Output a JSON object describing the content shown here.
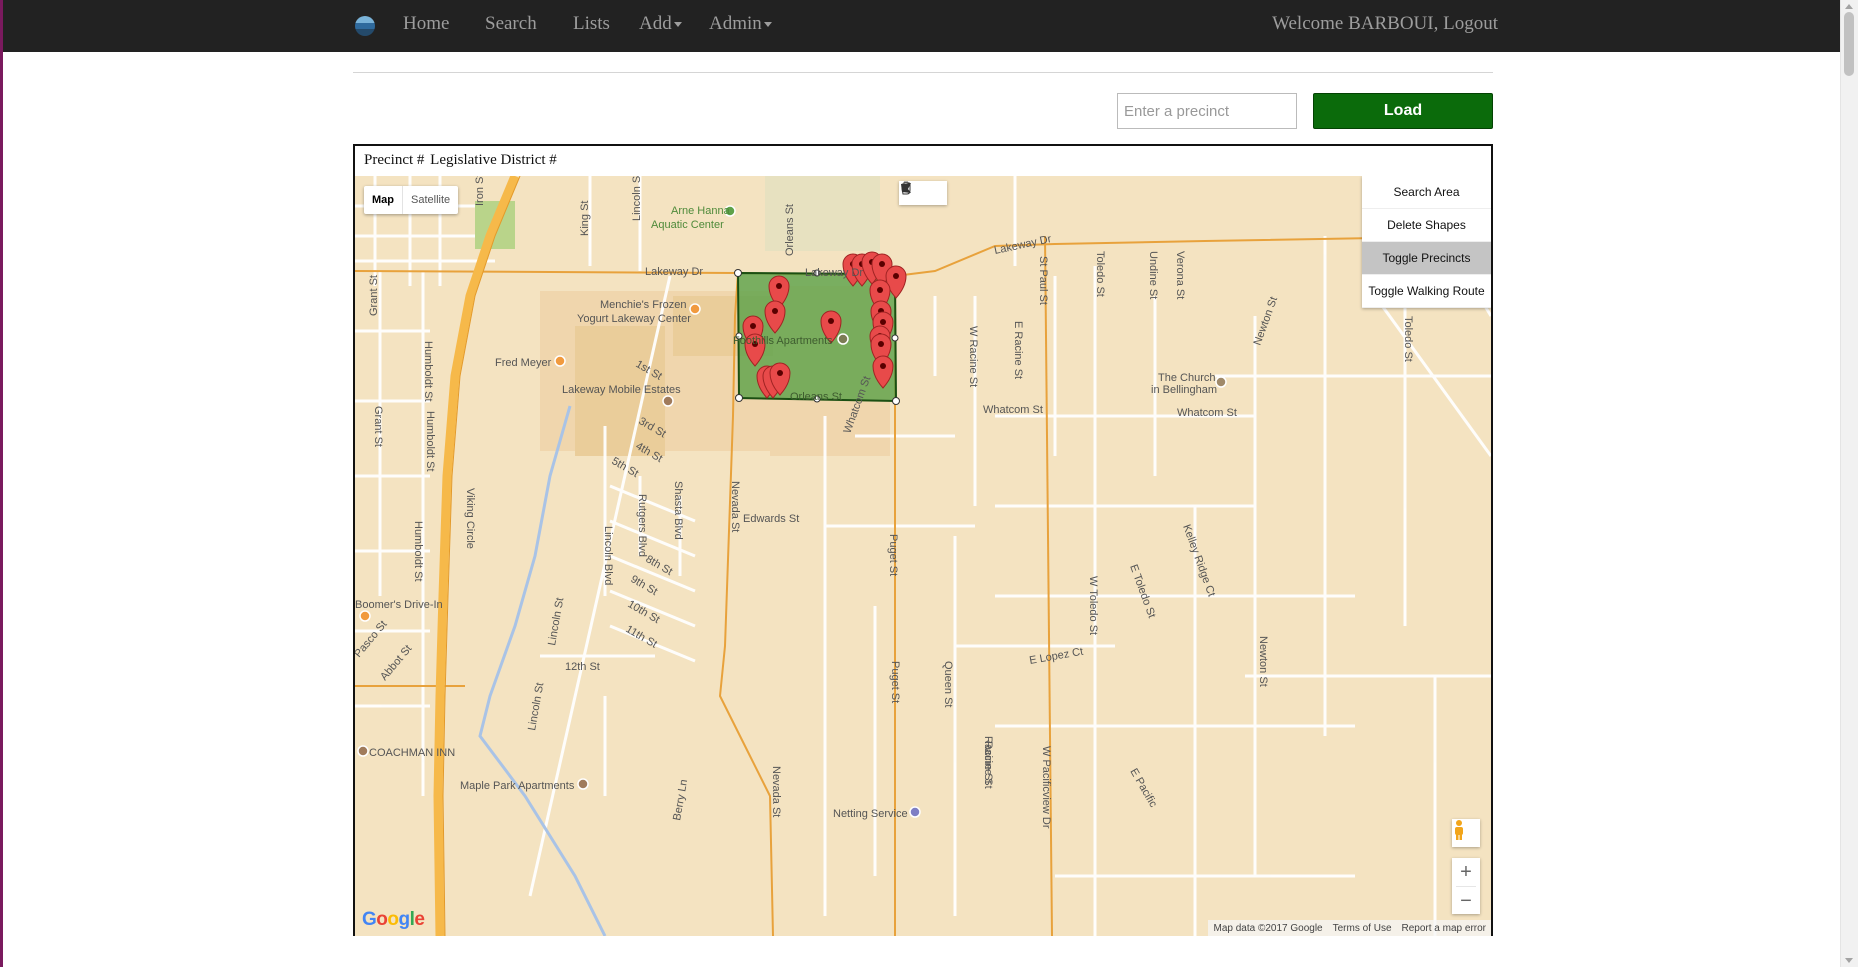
{
  "navbar": {
    "links": [
      {
        "label": "Home"
      },
      {
        "label": "Search"
      },
      {
        "label": "Lists"
      },
      {
        "label": "Add"
      },
      {
        "label": "Admin"
      }
    ],
    "welcome": "Welcome BARBOUI,",
    "logout": "Logout"
  },
  "search": {
    "placeholder": "Enter a precinct",
    "value": "",
    "load_label": "Load"
  },
  "map_panel": {
    "precinct_label": "Precinct #",
    "district_label": "Legislative District #"
  },
  "map": {
    "type_controls": {
      "map": "Map",
      "satellite": "Satellite",
      "selected": "Map"
    },
    "draw_tools": [
      {
        "icon": "hand-icon"
      },
      {
        "icon": "polygon-draw-icon"
      }
    ],
    "custom_controls": {
      "search_area": "Search Area",
      "delete_shapes": "Delete Shapes",
      "toggle_precincts": "Toggle Precincts",
      "toggle_walking_route": "Toggle Walking Route"
    },
    "zoom_in": "+",
    "zoom_out": "−",
    "logo": "Google",
    "attribution": {
      "data": "Map data ©2017 Google",
      "terms": "Terms of Use",
      "report": "Report a map error"
    },
    "colors": {
      "land": "#f4e3c1",
      "highway": "#f6b94a",
      "arterial": "#e8a23c",
      "selection_fill": "#5ea24a",
      "selection_stroke": "#1b4f12",
      "marker": "#e84a4a"
    },
    "labels": [
      "Iron St",
      "King St",
      "Lincoln St",
      "Arne Hanna",
      "Aquatic Center",
      "Orleans St",
      "Lakeway Dr",
      "Lakeway Dr",
      "Lakeway Dr",
      "Grant St",
      "Humboldt St",
      "Menchie's Frozen",
      "Yogurt Lakeway Center",
      "Fred Meyer",
      "1st St",
      "Lakeway Mobile Estates",
      "3rd St",
      "4th St",
      "5th St",
      "Shasta Blvd",
      "Rutgers Blvd",
      "Lincoln Blvd",
      "8th St",
      "9th St",
      "10th St",
      "11th St",
      "12th St",
      "Viking Circle",
      "Boomer's Drive-In",
      "Pasco St",
      "Abbot St",
      "COACHMAN INN",
      "Maple Park Apartments",
      "Nevada St",
      "Edwards St",
      "Puget St",
      "Queen St",
      "Racine St",
      "St Paul St",
      "Toledo St",
      "Undine St",
      "Verona St",
      "W Racine St",
      "E Racine St",
      "Whatcom St",
      "Whatcom St",
      "The Church",
      "in Bellingham",
      "Newton St",
      "Kelley Ridge Ct",
      "E Lopez Ct",
      "W Toledo St",
      "E Toledo St",
      "W Pacificview Dr",
      "E Pacific",
      "Netting Service",
      "Foothills Apartments",
      "Orleans St",
      "Whatcom St",
      "Undine St",
      "Toledo St",
      "Grant St",
      "Humboldt St",
      "Humboldt St",
      "Lincoln St",
      "Nevada St",
      "Puget St",
      "Lincoln St",
      "Berry Ln",
      "Racine St",
      "Newton St"
    ],
    "markers_count": 24
  }
}
